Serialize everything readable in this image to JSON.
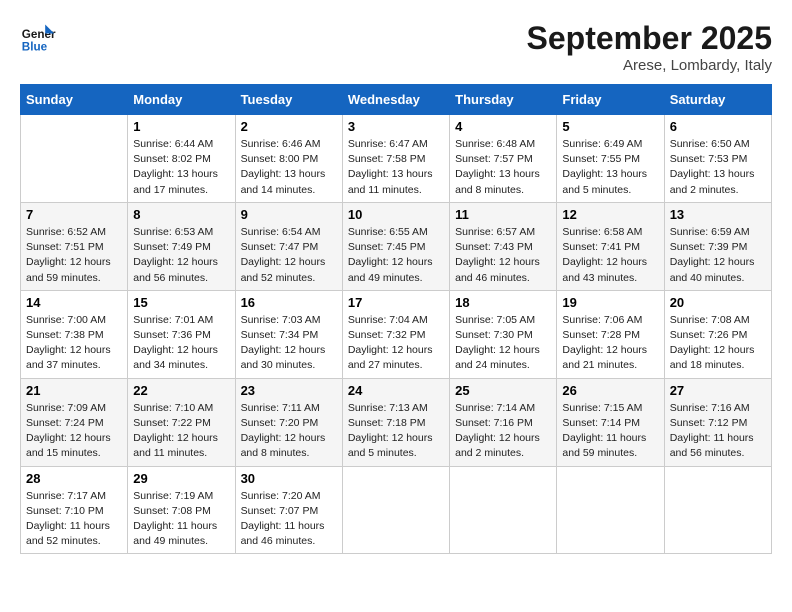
{
  "header": {
    "logo_general": "General",
    "logo_blue": "Blue",
    "month_title": "September 2025",
    "location": "Arese, Lombardy, Italy"
  },
  "days_of_week": [
    "Sunday",
    "Monday",
    "Tuesday",
    "Wednesday",
    "Thursday",
    "Friday",
    "Saturday"
  ],
  "weeks": [
    [
      {
        "day": "",
        "info": ""
      },
      {
        "day": "1",
        "info": "Sunrise: 6:44 AM\nSunset: 8:02 PM\nDaylight: 13 hours\nand 17 minutes."
      },
      {
        "day": "2",
        "info": "Sunrise: 6:46 AM\nSunset: 8:00 PM\nDaylight: 13 hours\nand 14 minutes."
      },
      {
        "day": "3",
        "info": "Sunrise: 6:47 AM\nSunset: 7:58 PM\nDaylight: 13 hours\nand 11 minutes."
      },
      {
        "day": "4",
        "info": "Sunrise: 6:48 AM\nSunset: 7:57 PM\nDaylight: 13 hours\nand 8 minutes."
      },
      {
        "day": "5",
        "info": "Sunrise: 6:49 AM\nSunset: 7:55 PM\nDaylight: 13 hours\nand 5 minutes."
      },
      {
        "day": "6",
        "info": "Sunrise: 6:50 AM\nSunset: 7:53 PM\nDaylight: 13 hours\nand 2 minutes."
      }
    ],
    [
      {
        "day": "7",
        "info": "Sunrise: 6:52 AM\nSunset: 7:51 PM\nDaylight: 12 hours\nand 59 minutes."
      },
      {
        "day": "8",
        "info": "Sunrise: 6:53 AM\nSunset: 7:49 PM\nDaylight: 12 hours\nand 56 minutes."
      },
      {
        "day": "9",
        "info": "Sunrise: 6:54 AM\nSunset: 7:47 PM\nDaylight: 12 hours\nand 52 minutes."
      },
      {
        "day": "10",
        "info": "Sunrise: 6:55 AM\nSunset: 7:45 PM\nDaylight: 12 hours\nand 49 minutes."
      },
      {
        "day": "11",
        "info": "Sunrise: 6:57 AM\nSunset: 7:43 PM\nDaylight: 12 hours\nand 46 minutes."
      },
      {
        "day": "12",
        "info": "Sunrise: 6:58 AM\nSunset: 7:41 PM\nDaylight: 12 hours\nand 43 minutes."
      },
      {
        "day": "13",
        "info": "Sunrise: 6:59 AM\nSunset: 7:39 PM\nDaylight: 12 hours\nand 40 minutes."
      }
    ],
    [
      {
        "day": "14",
        "info": "Sunrise: 7:00 AM\nSunset: 7:38 PM\nDaylight: 12 hours\nand 37 minutes."
      },
      {
        "day": "15",
        "info": "Sunrise: 7:01 AM\nSunset: 7:36 PM\nDaylight: 12 hours\nand 34 minutes."
      },
      {
        "day": "16",
        "info": "Sunrise: 7:03 AM\nSunset: 7:34 PM\nDaylight: 12 hours\nand 30 minutes."
      },
      {
        "day": "17",
        "info": "Sunrise: 7:04 AM\nSunset: 7:32 PM\nDaylight: 12 hours\nand 27 minutes."
      },
      {
        "day": "18",
        "info": "Sunrise: 7:05 AM\nSunset: 7:30 PM\nDaylight: 12 hours\nand 24 minutes."
      },
      {
        "day": "19",
        "info": "Sunrise: 7:06 AM\nSunset: 7:28 PM\nDaylight: 12 hours\nand 21 minutes."
      },
      {
        "day": "20",
        "info": "Sunrise: 7:08 AM\nSunset: 7:26 PM\nDaylight: 12 hours\nand 18 minutes."
      }
    ],
    [
      {
        "day": "21",
        "info": "Sunrise: 7:09 AM\nSunset: 7:24 PM\nDaylight: 12 hours\nand 15 minutes."
      },
      {
        "day": "22",
        "info": "Sunrise: 7:10 AM\nSunset: 7:22 PM\nDaylight: 12 hours\nand 11 minutes."
      },
      {
        "day": "23",
        "info": "Sunrise: 7:11 AM\nSunset: 7:20 PM\nDaylight: 12 hours\nand 8 minutes."
      },
      {
        "day": "24",
        "info": "Sunrise: 7:13 AM\nSunset: 7:18 PM\nDaylight: 12 hours\nand 5 minutes."
      },
      {
        "day": "25",
        "info": "Sunrise: 7:14 AM\nSunset: 7:16 PM\nDaylight: 12 hours\nand 2 minutes."
      },
      {
        "day": "26",
        "info": "Sunrise: 7:15 AM\nSunset: 7:14 PM\nDaylight: 11 hours\nand 59 minutes."
      },
      {
        "day": "27",
        "info": "Sunrise: 7:16 AM\nSunset: 7:12 PM\nDaylight: 11 hours\nand 56 minutes."
      }
    ],
    [
      {
        "day": "28",
        "info": "Sunrise: 7:17 AM\nSunset: 7:10 PM\nDaylight: 11 hours\nand 52 minutes."
      },
      {
        "day": "29",
        "info": "Sunrise: 7:19 AM\nSunset: 7:08 PM\nDaylight: 11 hours\nand 49 minutes."
      },
      {
        "day": "30",
        "info": "Sunrise: 7:20 AM\nSunset: 7:07 PM\nDaylight: 11 hours\nand 46 minutes."
      },
      {
        "day": "",
        "info": ""
      },
      {
        "day": "",
        "info": ""
      },
      {
        "day": "",
        "info": ""
      },
      {
        "day": "",
        "info": ""
      }
    ]
  ]
}
